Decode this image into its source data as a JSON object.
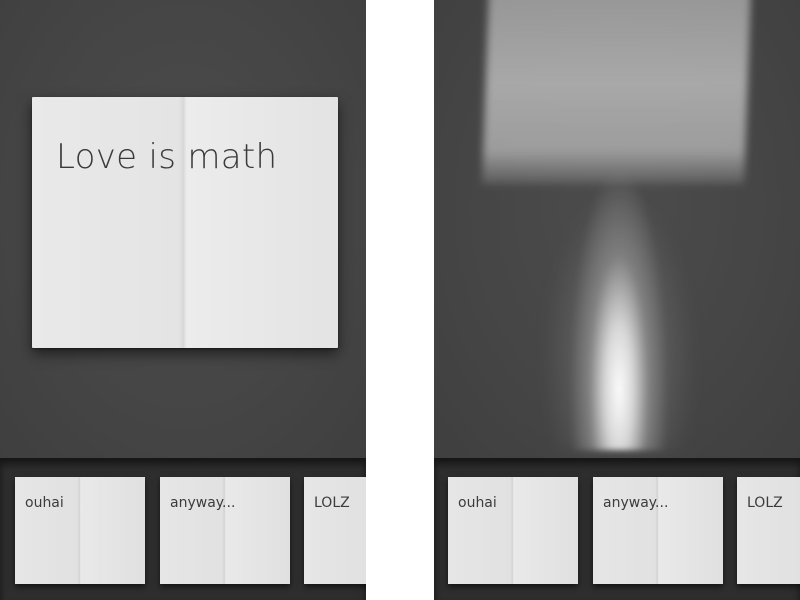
{
  "left_screen": {
    "open_note": {
      "title": "Love is math"
    },
    "tray": {
      "notes": [
        {
          "label": "ouhai"
        },
        {
          "label": "anyway..."
        },
        {
          "label": "LOLZ"
        }
      ]
    }
  },
  "right_screen": {
    "animation": "note-dissolving",
    "tray": {
      "notes": [
        {
          "label": "ouhai"
        },
        {
          "label": "anyway..."
        },
        {
          "label": "LOLZ"
        }
      ]
    }
  },
  "colors": {
    "background": "#474747",
    "tray": "#2e2e2e",
    "paper": "#e6e6e6",
    "text": "#3a3a3a",
    "divider": "#ffffff"
  }
}
